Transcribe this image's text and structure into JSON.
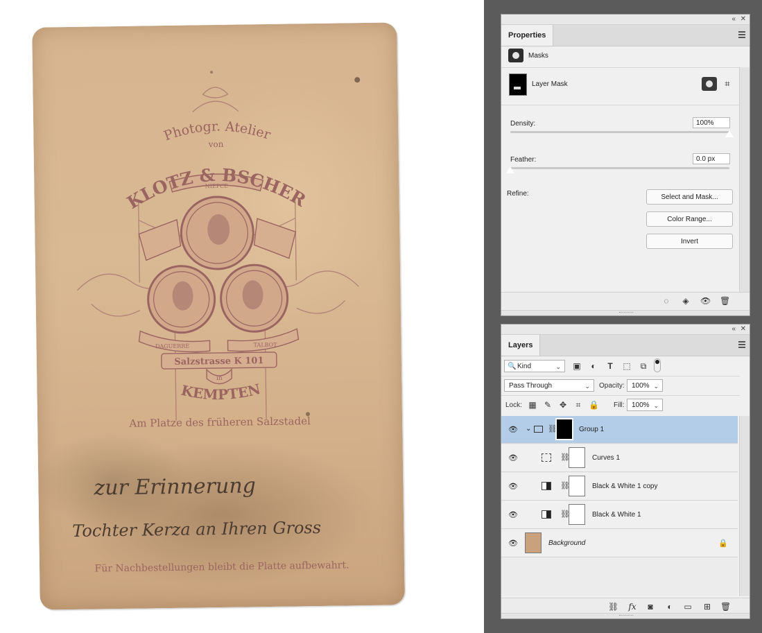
{
  "photo": {
    "stamp": {
      "line1": "Photogr. Atelier",
      "line2": "von",
      "studio": "KLOTZ & BSCHER",
      "banner_top": "NIEPCE",
      "banner_left": "DAGUERRE",
      "banner_right": "TALBOT",
      "street": "Salzstrasse K 101",
      "in": "in",
      "city": "KEMPTEN",
      "location": "Am Platze des früheren Salzstadel",
      "footer": "Für Nachbestellungen bleibt die Platte aufbewahrt."
    },
    "handwriting": {
      "line1": "zur Erinnerung",
      "line2": "Tochter Kerza an Ihren Gross"
    }
  },
  "properties": {
    "tab_label": "Properties",
    "section_label": "Masks",
    "layer_mask_label": "Layer Mask",
    "density": {
      "label": "Density:",
      "value": "100%",
      "fraction": 1.0
    },
    "feather": {
      "label": "Feather:",
      "value": "0.0 px",
      "fraction": 0.0
    },
    "refine_label": "Refine:",
    "buttons": {
      "select_and_mask": "Select and Mask...",
      "color_range": "Color Range...",
      "invert": "Invert"
    }
  },
  "layers": {
    "tab_label": "Layers",
    "kind_filter": "Kind",
    "blend_mode": "Pass Through",
    "opacity_label": "Opacity:",
    "opacity_value": "100%",
    "lock_label": "Lock:",
    "fill_label": "Fill:",
    "fill_value": "100%",
    "items": [
      {
        "name": "Group 1",
        "type": "group",
        "selected": true
      },
      {
        "name": "Curves 1",
        "type": "curves",
        "selected": false
      },
      {
        "name": "Black & White 1 copy",
        "type": "black-white",
        "selected": false
      },
      {
        "name": "Black & White 1",
        "type": "black-white",
        "selected": false
      },
      {
        "name": "Background",
        "type": "background",
        "selected": false
      }
    ]
  },
  "colors": {
    "selection": "#b3cde8",
    "dock": "#5b5b5b",
    "panel": "#f0f0f0",
    "stamp_ink": "#9a6560"
  }
}
